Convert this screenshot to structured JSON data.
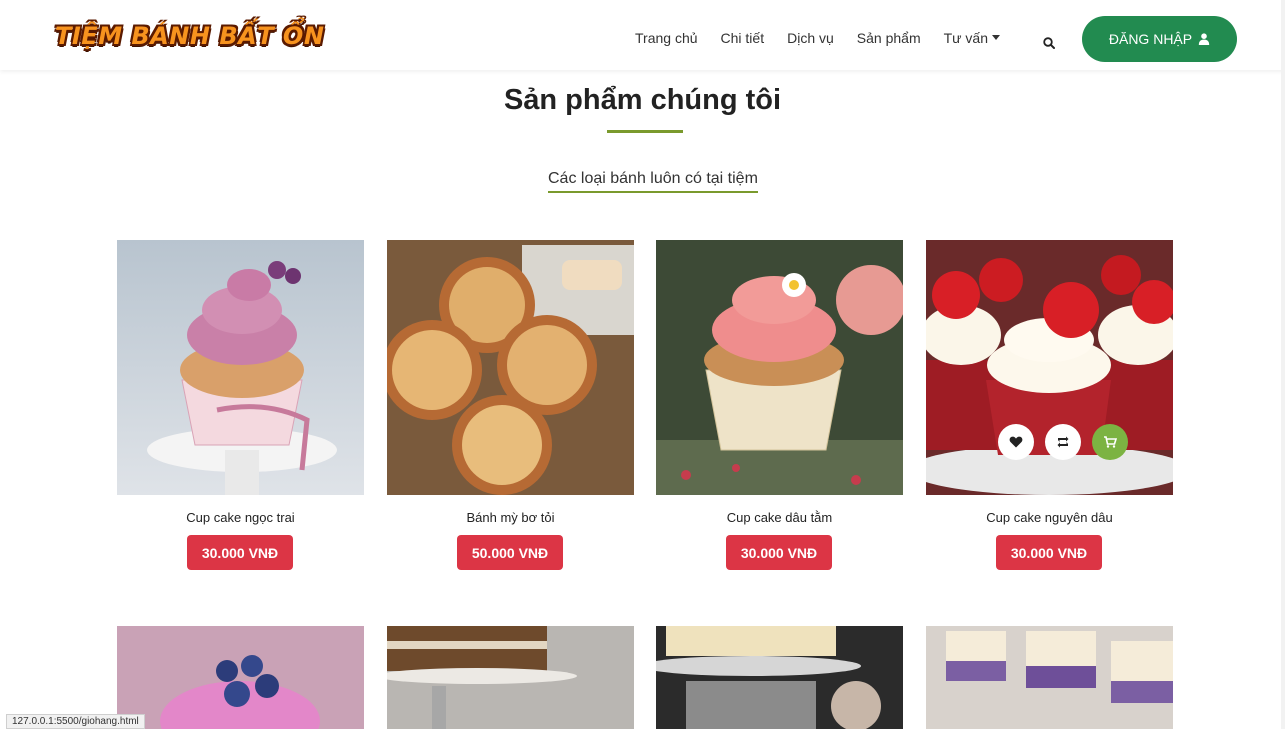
{
  "header": {
    "logo_text": "TIỆM BÁNH BẤT ỔN",
    "nav": [
      {
        "label": "Trang chủ"
      },
      {
        "label": "Chi tiết"
      },
      {
        "label": "Dịch vụ"
      },
      {
        "label": "Sản phẩm"
      },
      {
        "label": "Tư vấn"
      }
    ],
    "login_label": "ĐĂNG NHẬP"
  },
  "section": {
    "title": "Sản phẩm chúng tôi",
    "subtitle": "Các loại bánh luôn có tại tiệm"
  },
  "products": [
    {
      "name": "Cup cake ngọc trai",
      "price": "30.000 VNĐ"
    },
    {
      "name": "Bánh mỳ bơ tỏi",
      "price": "50.000 VNĐ"
    },
    {
      "name": "Cup cake dâu tằm",
      "price": "30.000 VNĐ"
    },
    {
      "name": "Cup cake nguyên dâu",
      "price": "30.000 VNĐ"
    }
  ],
  "status_url": "127.0.0.1:5500/giohang.html",
  "colors": {
    "brand_green": "#228b50",
    "price_red": "#dc3545",
    "accent_line": "#7a9a2d",
    "cart_green": "#7cb342"
  }
}
